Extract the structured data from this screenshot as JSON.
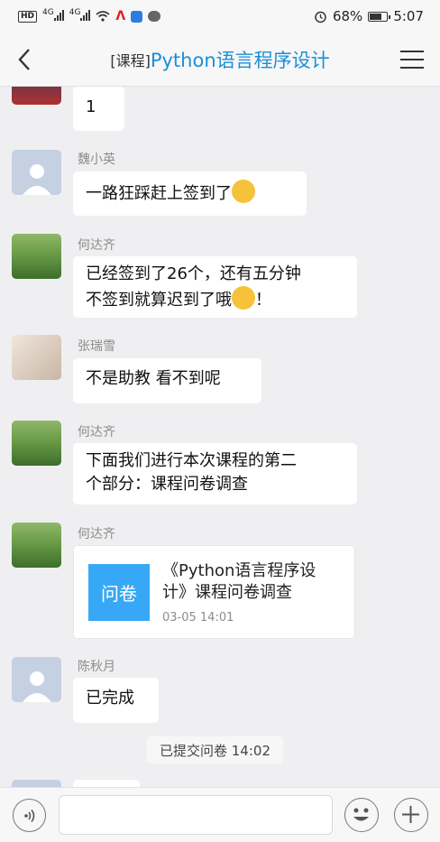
{
  "status_bar": {
    "hd": "HD",
    "sig1": "4G",
    "sig2": "4G",
    "battery_text": "68%",
    "battery_level": 0.68,
    "time": "5:07"
  },
  "header": {
    "tag": "[课程]",
    "name": "Python语言程序设计"
  },
  "messages": [
    {
      "sender": "",
      "text": "1"
    },
    {
      "sender": "魏小英",
      "text": "一路狂踩赶上签到了"
    },
    {
      "sender": "何达齐",
      "line1": "已经签到了26个，还有五分钟",
      "line2": "不签到就算迟到了哦",
      "tail": "！"
    },
    {
      "sender": "张瑞雪",
      "text": "不是助教 看不到呢"
    },
    {
      "sender": "何达齐",
      "line1": "下面我们进行本次课程的第二",
      "line2": "个部分：课程问卷调查"
    },
    {
      "sender": "何达齐",
      "card": {
        "badge": "问卷",
        "line1": "《Python语言程序设",
        "line2": "计》课程问卷调查",
        "time": "03-05 14:01"
      }
    },
    {
      "sender": "陈秋月",
      "text": "已完成"
    }
  ],
  "system_notice": "已提交问卷 14:02",
  "colors": {
    "accent": "#1a8fd8",
    "card_badge": "#37a8f5",
    "background": "#efeff1"
  }
}
